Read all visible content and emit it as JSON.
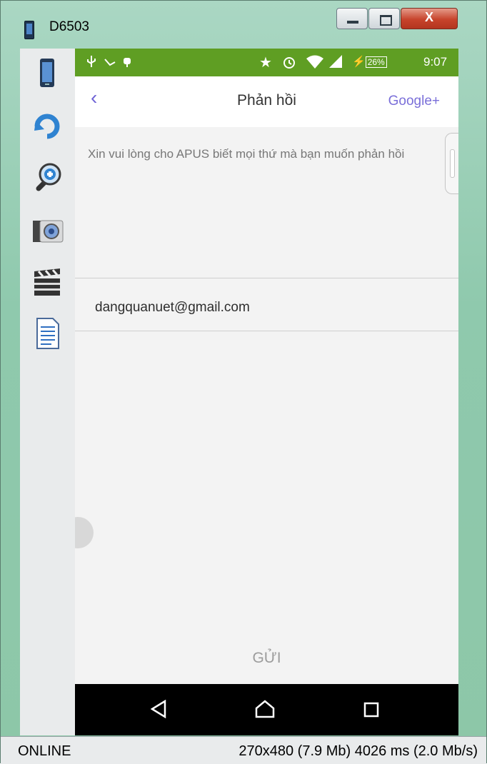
{
  "window": {
    "title": "D6503",
    "buttons": {
      "minimize": "minimize",
      "maximize": "maximize",
      "close": "X"
    }
  },
  "toolbar": {
    "tools": [
      "device-icon",
      "rotate-icon",
      "zoom-icon",
      "camera-icon",
      "video-clapper-icon",
      "document-icon"
    ]
  },
  "statusbar": {
    "left_icons": [
      "usb-icon",
      "debug-icon",
      "android-icon"
    ],
    "right_icons": [
      "star-icon",
      "alarm-icon",
      "wifi-icon",
      "signal-icon"
    ],
    "battery": "26%",
    "time": "9:07"
  },
  "app": {
    "title": "Phản hồi",
    "google_plus": "Google+",
    "feedback_placeholder": "Xin vui lòng cho APUS biết mọi thứ mà bạn muốn phản hồi",
    "email": "dangquanuet@gmail.com",
    "send": "GỬI"
  },
  "navbar": {
    "buttons": [
      "back-icon",
      "home-icon",
      "recents-icon"
    ]
  },
  "status": {
    "connection": "ONLINE",
    "info": "270x480 (7.9 Mb)  4026 ms (2.0 Mb/s)"
  },
  "colors": {
    "statusbar": "#5f9e23",
    "accent": "#7a6fd9",
    "window_frame": "#8fc9ad"
  }
}
